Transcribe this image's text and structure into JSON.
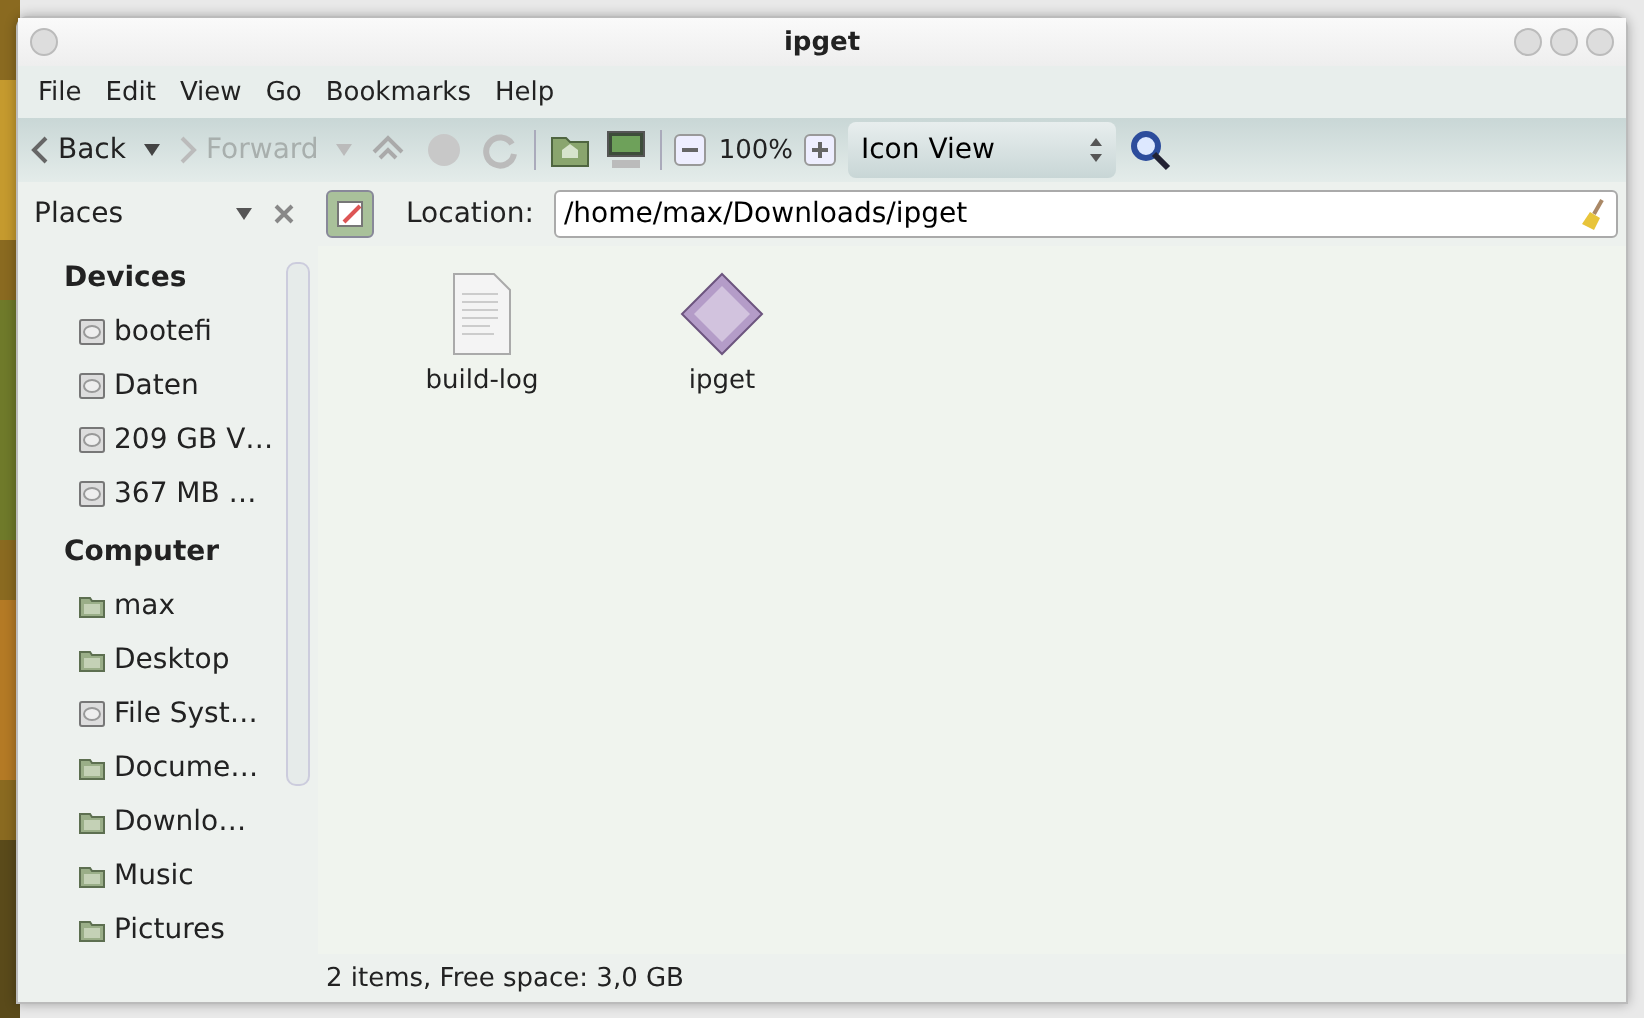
{
  "window": {
    "title": "ipget"
  },
  "menu": [
    "File",
    "Edit",
    "View",
    "Go",
    "Bookmarks",
    "Help"
  ],
  "toolbar": {
    "back": {
      "label": "Back",
      "disabled": false
    },
    "forward": {
      "label": "Forward",
      "disabled": true
    },
    "zoom": "100%",
    "view": "Icon View"
  },
  "sidebar": {
    "title": "Places",
    "sections": [
      {
        "heading": "Devices",
        "items": [
          {
            "label": "bootefi",
            "kind": "drive"
          },
          {
            "label": "Daten",
            "kind": "drive"
          },
          {
            "label": "209 GB V…",
            "kind": "drive"
          },
          {
            "label": "367 MB …",
            "kind": "drive"
          }
        ]
      },
      {
        "heading": "Computer",
        "items": [
          {
            "label": "max",
            "kind": "folder"
          },
          {
            "label": "Desktop",
            "kind": "folder"
          },
          {
            "label": "File Syst…",
            "kind": "drive"
          },
          {
            "label": "Docume…",
            "kind": "folder"
          },
          {
            "label": "Downlo…",
            "kind": "folder"
          },
          {
            "label": "Music",
            "kind": "folder"
          },
          {
            "label": "Pictures",
            "kind": "folder"
          }
        ]
      }
    ]
  },
  "location": {
    "label": "Location:",
    "value": "/home/max/Downloads/ipget"
  },
  "files": [
    {
      "name": "build-log",
      "kind": "text"
    },
    {
      "name": "ipget",
      "kind": "executable"
    }
  ],
  "status_bar": "2 items, Free space: 3,0 GB"
}
